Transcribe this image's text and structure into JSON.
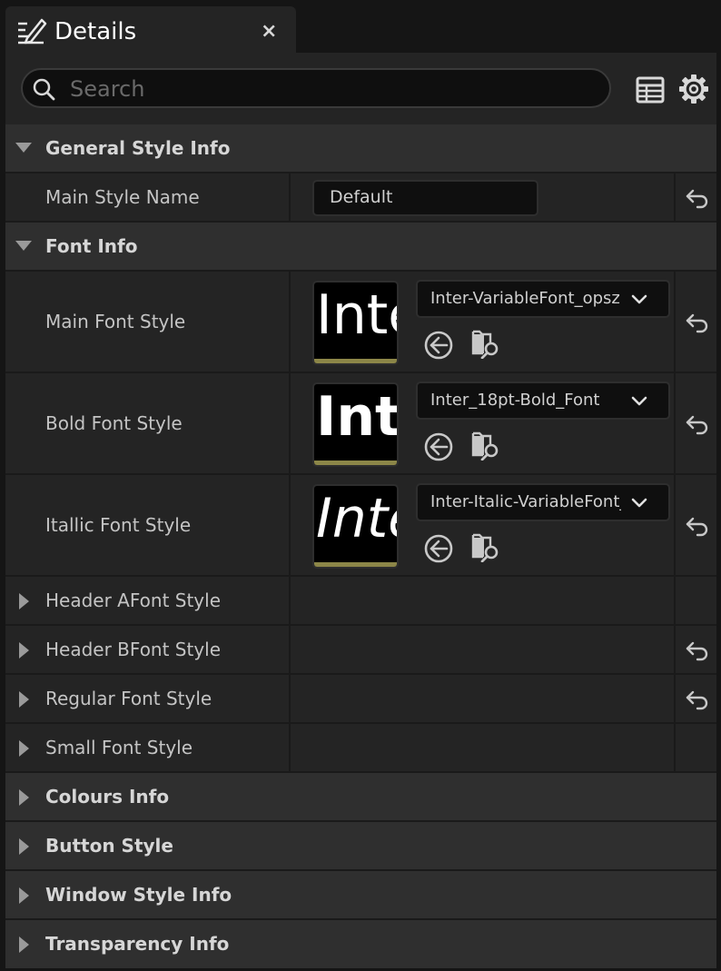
{
  "tab": {
    "title": "Details",
    "close": "×"
  },
  "search": {
    "placeholder": "Search"
  },
  "icons": {
    "tab": "edit-details-icon",
    "search": "search-icon",
    "table": "table-view-icon",
    "settings": "gear-icon",
    "reset": "reset-to-default-icon",
    "use_selected": "use-selected-asset-icon",
    "browse": "browse-to-asset-icon"
  },
  "colors": {
    "background": "#242424",
    "category": "#2f2f2f",
    "input": "#0f0f0f",
    "thumb_bar": "#8c8648"
  },
  "sections": {
    "general": {
      "label": "General Style Info",
      "expanded": true
    },
    "font": {
      "label": "Font Info",
      "expanded": true
    },
    "colours": {
      "label": "Colours Info",
      "expanded": false
    },
    "button": {
      "label": "Button Style",
      "expanded": false
    },
    "window": {
      "label": "Window Style Info",
      "expanded": false
    },
    "transparency": {
      "label": "Transparency Info",
      "expanded": false
    }
  },
  "main_style": {
    "label": "Main Style Name",
    "value": "Default"
  },
  "font_properties": [
    {
      "label": "Main Font Style",
      "thumb_text": "Inte",
      "asset": "Inter-VariableFont_opsz,wght_Font"
    },
    {
      "label": "Bold Font Style",
      "thumb_text": "Int",
      "asset": "Inter_18pt-Bold_Font"
    },
    {
      "label": "Itallic Font Style",
      "thumb_text": "Inte",
      "asset": "Inter-Italic-VariableFont_Font"
    }
  ],
  "collapsed_properties": [
    {
      "label": "Header AFont Style",
      "has_reset": false
    },
    {
      "label": "Header BFont Style",
      "has_reset": true
    },
    {
      "label": "Regular Font Style",
      "has_reset": true
    },
    {
      "label": "Small Font Style",
      "has_reset": false
    }
  ]
}
